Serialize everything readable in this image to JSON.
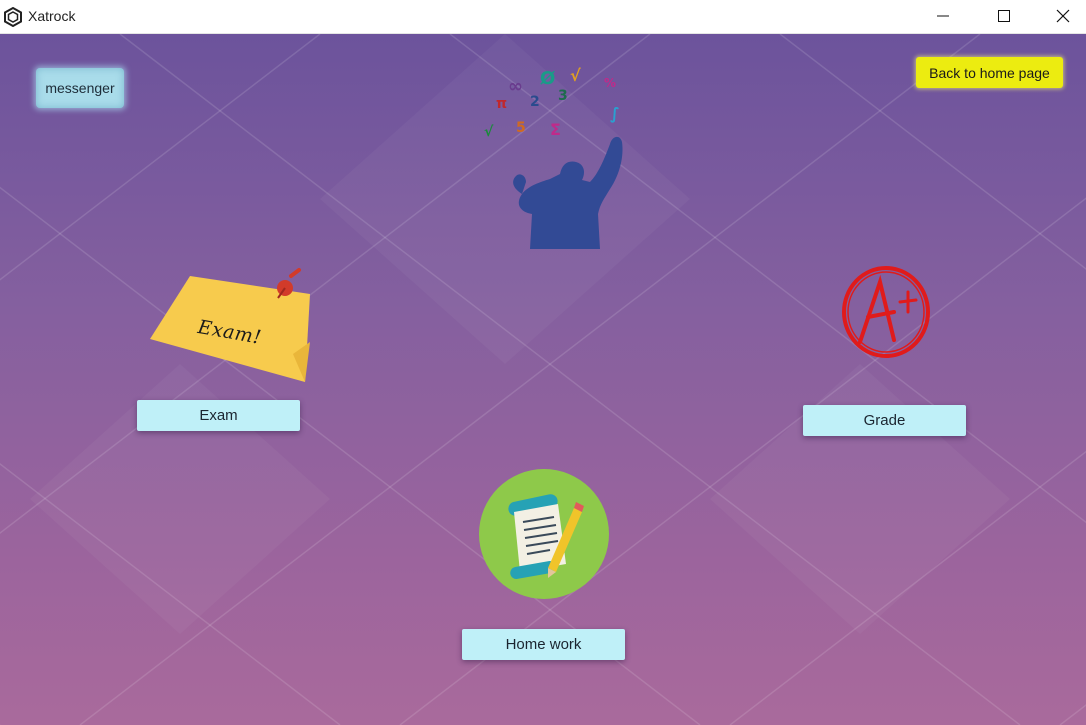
{
  "window": {
    "title": "Xatrock"
  },
  "buttons": {
    "messenger": "messenger",
    "back_home": "Back to home page",
    "exam": "Exam",
    "grade": "Grade",
    "homework": "Home work"
  },
  "images": {
    "exam_note_text": "Exam!",
    "math_symbols": [
      "∞",
      "π",
      "Ø",
      "2",
      "3",
      "5",
      "√",
      "Σ",
      "%",
      "∫",
      "√"
    ]
  },
  "icons": {
    "app": "hexagon-app-icon",
    "minimize": "minimize-icon",
    "maximize": "maximize-icon",
    "close": "close-icon"
  },
  "colors": {
    "background_top": "#6c539c",
    "background_bottom": "#a96a9c",
    "home_button": "#ecec10",
    "action_button": "#bff0f8",
    "messenger_button": "#a9dcea"
  }
}
